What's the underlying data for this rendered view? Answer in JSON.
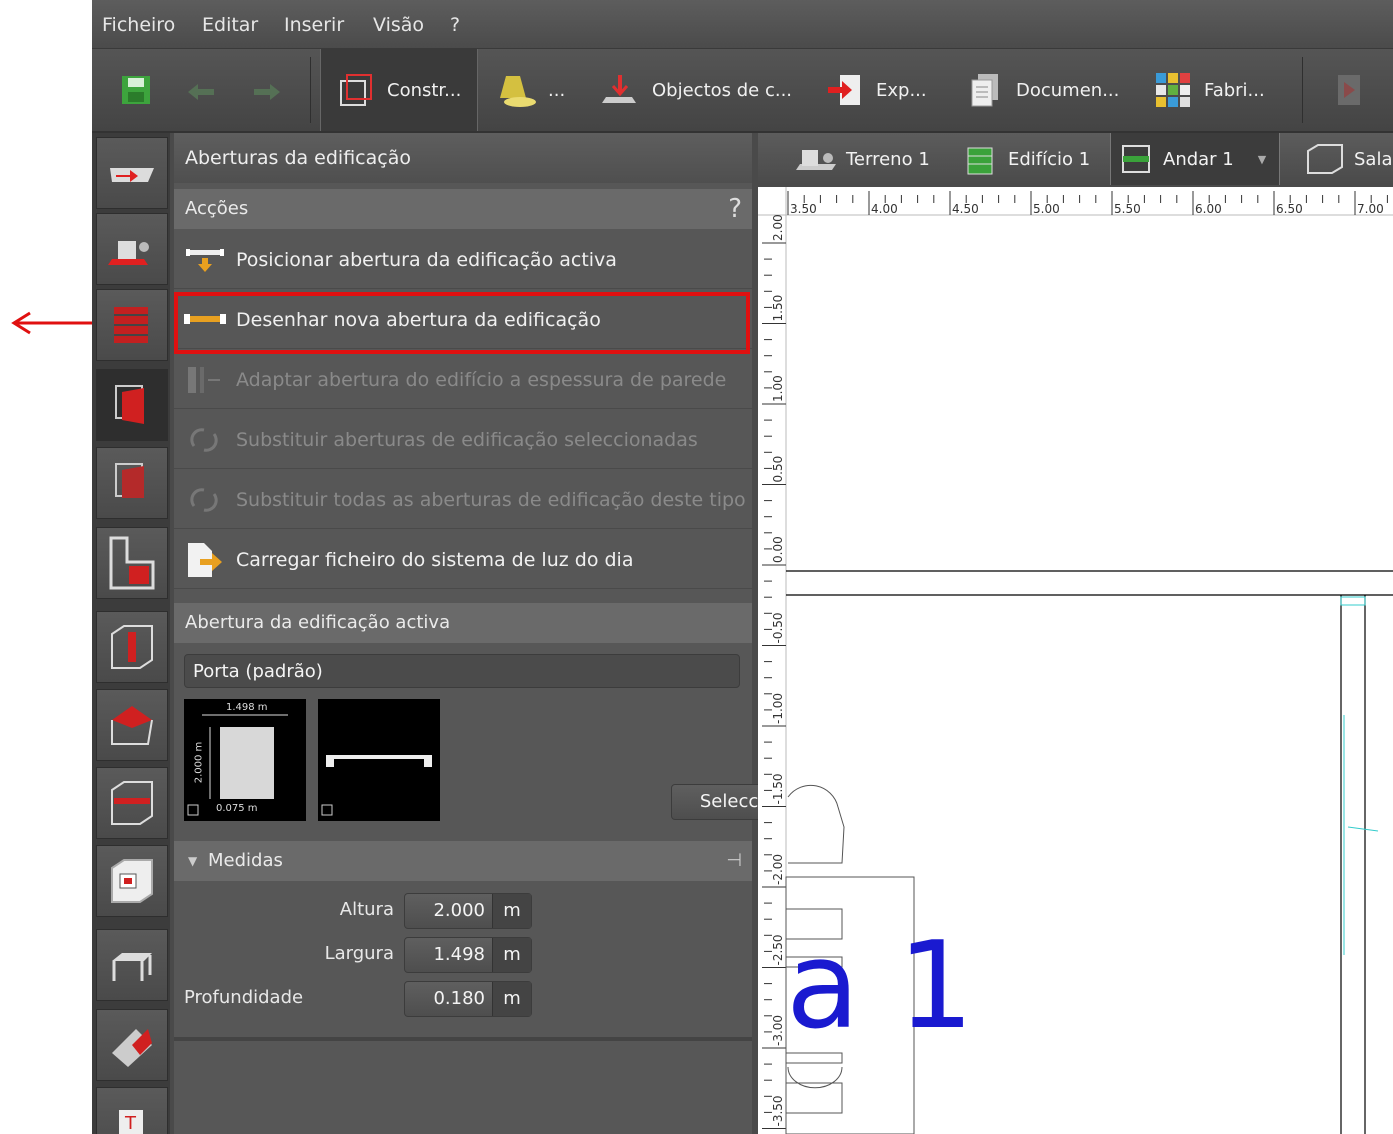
{
  "menu": [
    "Ficheiro",
    "Editar",
    "Inserir",
    "Visão",
    "?"
  ],
  "toolbar": {
    "items": [
      {
        "label": "Constr...",
        "icon": "construction-icon"
      },
      {
        "label": "...",
        "icon": "lamp-icon"
      },
      {
        "label": "Objectos de c...",
        "icon": "objects-icon"
      },
      {
        "label": "Exp...",
        "icon": "export-icon"
      },
      {
        "label": "Documen...",
        "icon": "document-icon"
      },
      {
        "label": "Fabri...",
        "icon": "manufacturer-icon"
      }
    ]
  },
  "panel": {
    "title": "Aberturas da edificação",
    "actions_header": "Acções",
    "help": "?",
    "actions": [
      {
        "label": "Posicionar abertura da edificação activa",
        "enabled": true
      },
      {
        "label": "Desenhar nova abertura da edificação",
        "enabled": true
      },
      {
        "label": "Adaptar abertura do edifício a espessura de parede",
        "enabled": false
      },
      {
        "label": "Substituir aberturas de edificação seleccionadas",
        "enabled": false
      },
      {
        "label": "Substituir todas as aberturas de edificação deste tipo",
        "enabled": false
      },
      {
        "label": "Carregar ficheiro do sistema de luz do dia",
        "enabled": true
      }
    ],
    "active_opening": {
      "header": "Abertura da edificação activa",
      "type": "Porta (padrão)",
      "preview_width": "1.498 m",
      "preview_height": "2.000 m",
      "preview_depth": "0.075 m",
      "select_label": "Seleccionar"
    },
    "measures": {
      "header": "Medidas",
      "fields": [
        {
          "label": "Altura",
          "value": "2.000",
          "unit": "m"
        },
        {
          "label": "Largura",
          "value": "1.498",
          "unit": "m"
        },
        {
          "label": "Profundidade",
          "value": "0.180",
          "unit": "m"
        }
      ]
    }
  },
  "view_tabs": [
    "Terreno 1",
    "Edifício 1",
    "Andar 1",
    "Sala"
  ],
  "ruler": {
    "horizontal": [
      "3.50",
      "4.00",
      "4.50",
      "5.00",
      "5.50",
      "6.00",
      "6.50",
      "7.00"
    ],
    "vertical": [
      "2.00",
      "1.50",
      "1.00",
      "0.50",
      "0.00",
      "-0.50",
      "-1.00",
      "-1.50",
      "-2.00",
      "-2.50",
      "-3.00",
      "-3.50"
    ]
  },
  "canvas_label": "a 1",
  "colors": {
    "highlight": "#e01010",
    "label": "#1a1ad0",
    "accent": "#cc2020"
  }
}
